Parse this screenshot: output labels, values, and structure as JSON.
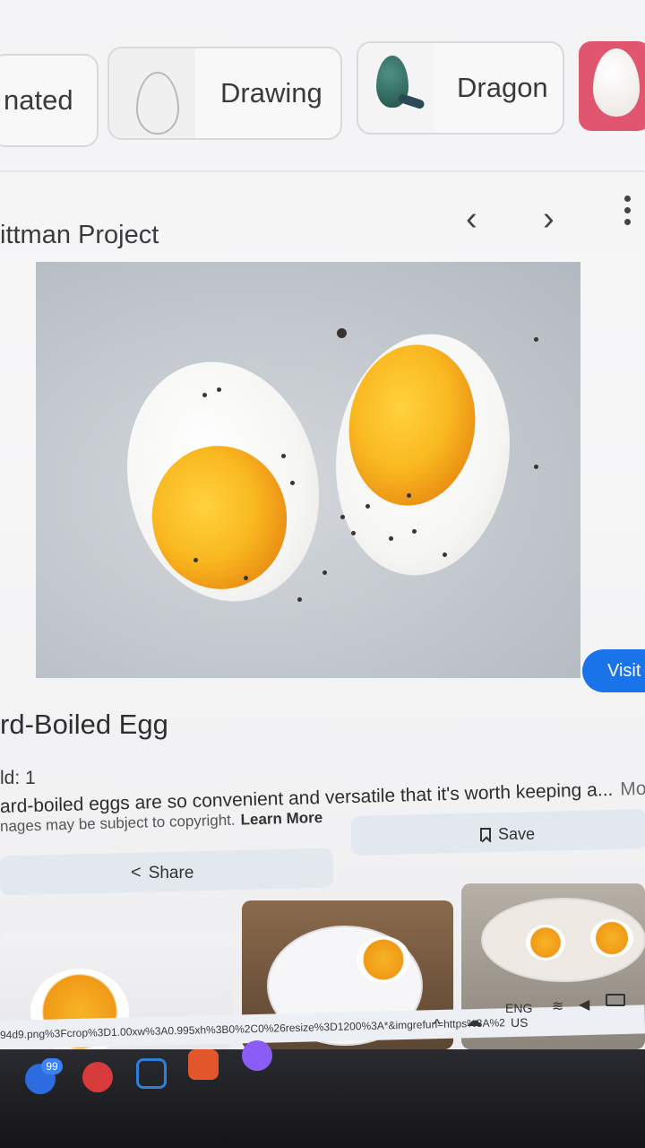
{
  "chips": [
    {
      "label": "nated"
    },
    {
      "label": "Drawing"
    },
    {
      "label": "Dragon"
    }
  ],
  "panel": {
    "source_title": "ittman Project",
    "prev_label": "‹",
    "next_label": "›"
  },
  "result": {
    "visit_label": "Visit",
    "title": "rd-Boiled Egg",
    "yield": "ld: 1",
    "description": "ard-boiled eggs are so convenient and versatile that it's worth keeping a...",
    "more_label": "More",
    "copyright_text": "nages may be subject to copyright.",
    "learn_more_label": "Learn More",
    "save_label": "Save",
    "share_label": "Share"
  },
  "status_bar": {
    "url": "94d9.png%3Fcrop%3D1.00xw%3A0.995xh%3B0%2C0%26resize%3D1200%3A*&imgrefurl=https%3A%2",
    "lang": "ENG",
    "region": "US",
    "badge_count": "99"
  },
  "icons": {
    "search_icon": "search-icon",
    "bookmark_icon": "bookmark-icon",
    "share_icon": "share-icon"
  },
  "colors": {
    "accent": "#1a73e8",
    "yolk": "#f9b820"
  }
}
